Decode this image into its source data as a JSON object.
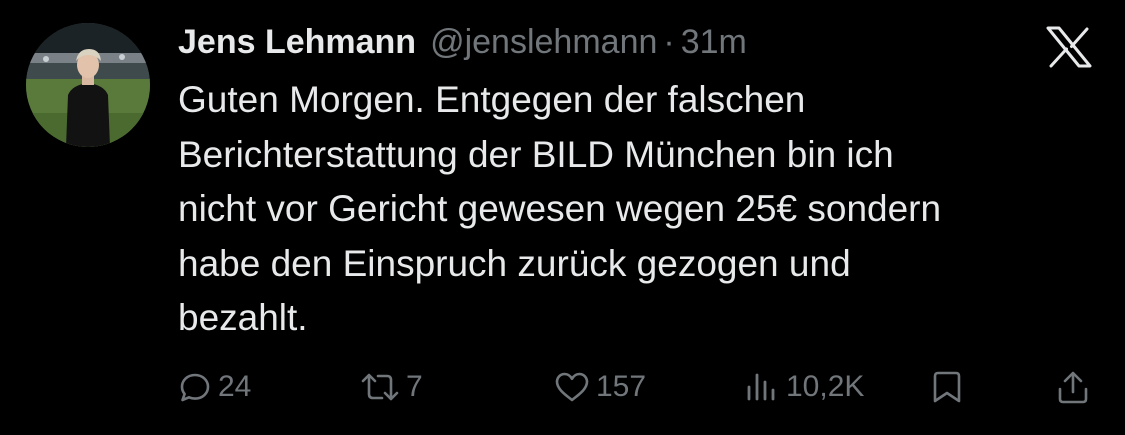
{
  "tweet": {
    "author": {
      "display_name": "Jens Lehmann",
      "handle": "@jenslehmann",
      "separator": "·",
      "time": "31m"
    },
    "text_lines": [
      "Guten Morgen. Entgegen der falschen",
      "Berichterstattung der BILD München bin ich",
      "nicht vor Gericht gewesen wegen 25€ sondern",
      "habe den Einspruch zurück gezogen und",
      "bezahlt."
    ],
    "stats": {
      "replies": "24",
      "reposts": "7",
      "likes": "157",
      "views": "10,2K"
    }
  },
  "icons": {
    "logo": "x-logo-icon",
    "reply": "reply-icon",
    "repost": "repost-icon",
    "like": "heart-icon",
    "views": "views-icon",
    "bookmark": "bookmark-icon",
    "share": "share-icon"
  },
  "colors": {
    "background": "#000000",
    "primary_text": "#e7e9ea",
    "secondary_text": "#71767b"
  }
}
